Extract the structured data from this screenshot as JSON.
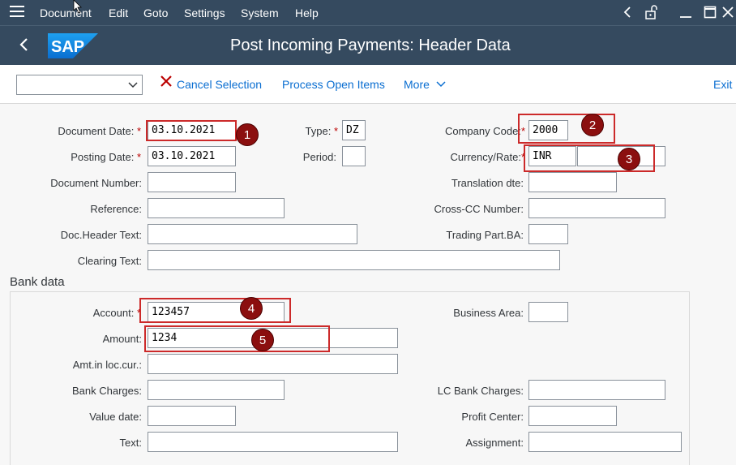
{
  "menubar": {
    "items": [
      "Document",
      "Edit",
      "Goto",
      "Settings",
      "System",
      "Help"
    ]
  },
  "header": {
    "title": "Post Incoming Payments: Header Data",
    "logo_text": "SAP"
  },
  "toolbar": {
    "select_value": "",
    "cancel_label": "Cancel Selection",
    "process_label": "Process Open Items",
    "more_label": "More",
    "exit_label": "Exit"
  },
  "form": {
    "document_date": {
      "label": "Document Date:",
      "value": "03.10.2021"
    },
    "posting_date": {
      "label": "Posting Date:",
      "value": "03.10.2021"
    },
    "document_number": {
      "label": "Document Number:",
      "value": ""
    },
    "reference": {
      "label": "Reference:",
      "value": ""
    },
    "doc_header_text": {
      "label": "Doc.Header Text:",
      "value": ""
    },
    "clearing_text": {
      "label": "Clearing Text:",
      "value": ""
    },
    "type": {
      "label": "Type:",
      "value": "DZ"
    },
    "period": {
      "label": "Period:",
      "value": ""
    },
    "company_code": {
      "label": "Company Code:",
      "value": "2000"
    },
    "currency_rate": {
      "label": "Currency/Rate:",
      "currency": "INR",
      "rate": ""
    },
    "translation_date": {
      "label": "Translation dte:",
      "value": ""
    },
    "cross_cc_number": {
      "label": "Cross-CC Number:",
      "value": ""
    },
    "trading_part_ba": {
      "label": "Trading Part.BA:",
      "value": ""
    }
  },
  "bank": {
    "section_title": "Bank data",
    "account": {
      "label": "Account:",
      "value": "123457"
    },
    "amount": {
      "label": "Amount:",
      "value": "1234"
    },
    "amt_loc_cur": {
      "label": "Amt.in loc.cur.:",
      "value": ""
    },
    "bank_charges": {
      "label": "Bank Charges:",
      "value": ""
    },
    "value_date": {
      "label": "Value date:",
      "value": ""
    },
    "text": {
      "label": "Text:",
      "value": ""
    },
    "business_area": {
      "label": "Business Area:",
      "value": ""
    },
    "lc_bank_charges": {
      "label": "LC Bank Charges:",
      "value": ""
    },
    "profit_center": {
      "label": "Profit Center:",
      "value": ""
    },
    "assignment": {
      "label": "Assignment:",
      "value": ""
    }
  },
  "markers": [
    "1",
    "2",
    "3",
    "4",
    "5"
  ],
  "required_mark": "*",
  "colors": {
    "shell": "#354a5f",
    "link": "#0a6ed1",
    "highlight": "#cc2a2a",
    "marker": "#8b0f0f"
  }
}
